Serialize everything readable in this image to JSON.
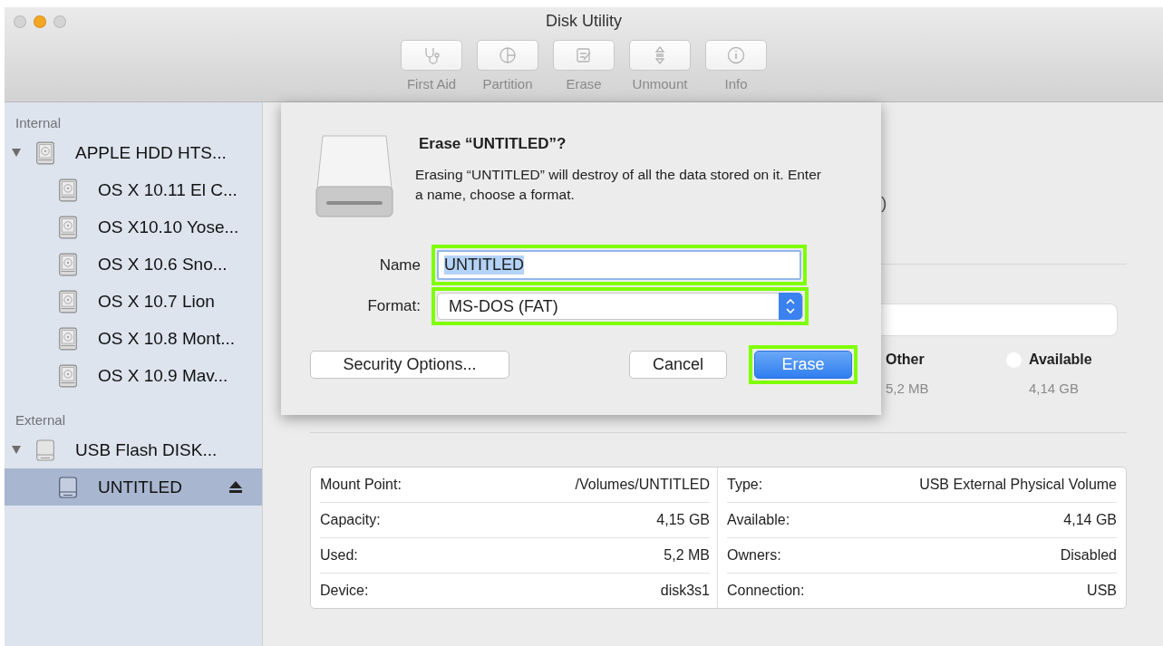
{
  "window": {
    "title": "Disk Utility",
    "controls": [
      {
        "color": "#d4d4d4"
      },
      {
        "color": "#f5a623"
      },
      {
        "color": "#d4d4d4"
      }
    ]
  },
  "toolbar": [
    {
      "label": "First Aid",
      "disabled": true
    },
    {
      "label": "Partition",
      "disabled": true
    },
    {
      "label": "Erase",
      "disabled": true
    },
    {
      "label": "Unmount",
      "disabled": true
    },
    {
      "label": "Info",
      "disabled": true
    }
  ],
  "sidebar": {
    "sections": [
      {
        "title": "Internal",
        "items": [
          {
            "label": "APPLE HDD HTS...",
            "kind": "hdd",
            "expanded": true,
            "selected": false,
            "children": [
              {
                "label": "OS X 10.11 El C...",
                "kind": "hdd",
                "selected": false
              },
              {
                "label": "OS X10.10 Yose...",
                "kind": "hdd",
                "selected": false
              },
              {
                "label": "OS X 10.6 Sno...",
                "kind": "hdd",
                "selected": false
              },
              {
                "label": "OS X 10.7 Lion",
                "kind": "hdd",
                "selected": false
              },
              {
                "label": "OS X 10.8 Mont...",
                "kind": "hdd",
                "selected": false
              },
              {
                "label": "OS X 10.9 Mav...",
                "kind": "hdd",
                "selected": false
              }
            ]
          }
        ]
      },
      {
        "title": "External",
        "items": [
          {
            "label": "USB Flash DISK...",
            "kind": "external",
            "expanded": true,
            "selected": false,
            "children": [
              {
                "label": "UNTITLED",
                "kind": "volume",
                "selected": true,
                "ejectable": true
              }
            ]
          }
        ]
      }
    ]
  },
  "volume_fragment": ")",
  "usage": {
    "legend": [
      {
        "label": "Other",
        "value": "5,2 MB"
      },
      {
        "label": "Available",
        "value": "4,14 GB",
        "color": "#ffffff"
      }
    ]
  },
  "info_table": {
    "columns": [
      [
        {
          "label": "Mount Point:",
          "value": "/Volumes/UNTITLED"
        },
        {
          "label": "Capacity:",
          "value": "4,15 GB"
        },
        {
          "label": "Used:",
          "value": "5,2 MB"
        },
        {
          "label": "Device:",
          "value": "disk3s1"
        }
      ],
      [
        {
          "label": "Type:",
          "value": "USB External Physical Volume"
        },
        {
          "label": "Available:",
          "value": "4,14 GB"
        },
        {
          "label": "Owners:",
          "value": "Disabled"
        },
        {
          "label": "Connection:",
          "value": "USB"
        }
      ]
    ]
  },
  "dialog": {
    "title": "Erase “UNTITLED”?",
    "message": "Erasing “UNTITLED” will destroy of all the data stored on it. Enter a name, choose a format.",
    "name_field": {
      "label": "Name",
      "value": "UNTITLED",
      "text_selected": true,
      "highlighted": true
    },
    "format_field": {
      "label": "Format:",
      "value": "MS-DOS (FAT)",
      "highlighted": true
    },
    "buttons": [
      {
        "label": "Security Options...",
        "kind": "secondary",
        "highlighted": false
      },
      {
        "label": "Cancel",
        "kind": "secondary",
        "highlighted": false
      },
      {
        "label": "Erase",
        "kind": "default",
        "highlighted": true
      }
    ]
  }
}
